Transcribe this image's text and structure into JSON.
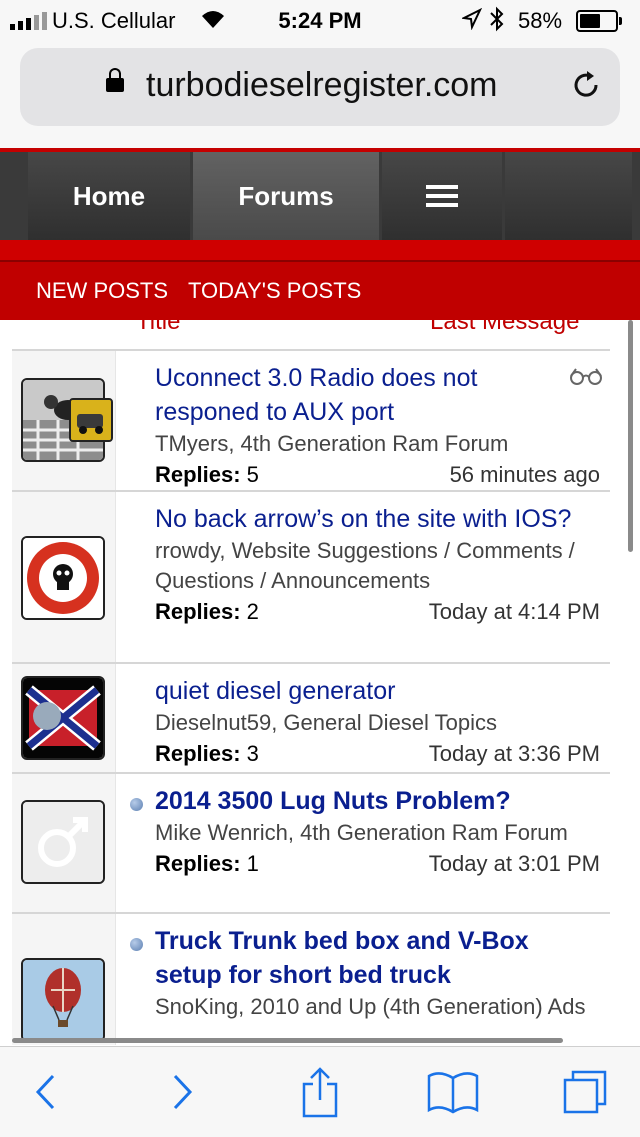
{
  "status": {
    "carrier": "U.S. Cellular",
    "time": "5:24 PM",
    "battery": "58%"
  },
  "browser": {
    "url": "turbodieselregister.com"
  },
  "nav": {
    "home": "Home",
    "forums": "Forums"
  },
  "subnav": {
    "new_posts": "NEW POSTS",
    "todays_posts": "TODAY'S POSTS"
  },
  "columns": {
    "title": "Title",
    "last": "Last Message"
  },
  "threads": [
    {
      "title": "Uconnect 3.0 Radio does not responed to AUX port",
      "meta": "TMyers, 4th Generation Ram Forum",
      "replies_label": "Replies:",
      "replies": "5",
      "time": "56 minutes ago"
    },
    {
      "title": "No back arrow’s on the site with IOS?",
      "meta": "rrowdy, Website Suggestions / Comments / Questions / Announcements",
      "replies_label": "Replies:",
      "replies": "2",
      "time": "Today at 4:14 PM"
    },
    {
      "title": "quiet diesel generator",
      "meta": "Dieselnut59, General Diesel Topics",
      "replies_label": "Replies:",
      "replies": "3",
      "time": "Today at 3:36 PM"
    },
    {
      "title": "2014 3500 Lug Nuts Problem?",
      "meta": "Mike Wenrich, 4th Generation Ram Forum",
      "replies_label": "Replies:",
      "replies": "1",
      "time": "Today at 3:01 PM"
    },
    {
      "title": "Truck Trunk bed box and V-Box setup for short bed truck",
      "meta": "SnoKing, 2010 and Up (4th Generation) Ads"
    }
  ],
  "colors": {
    "accent_red": "#c00000",
    "link_blue": "#0a1f8f",
    "ios_blue": "#1a73e8"
  }
}
